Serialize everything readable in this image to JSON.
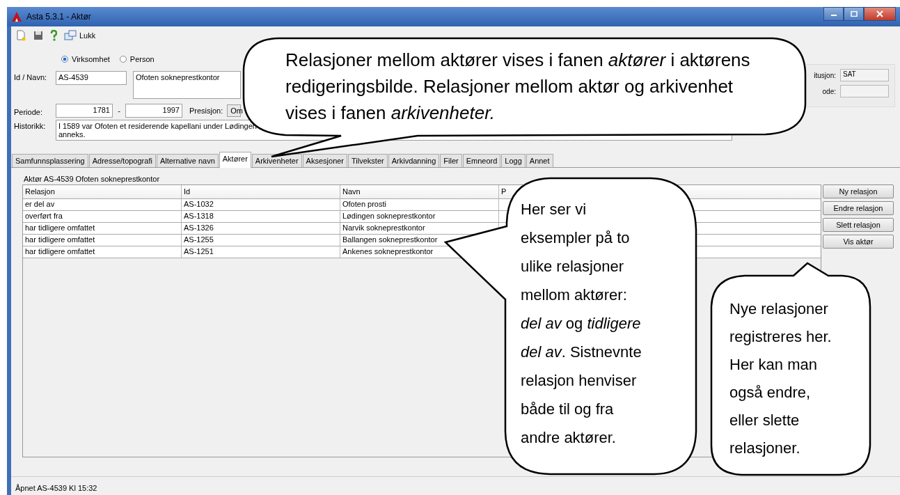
{
  "window": {
    "title": "Asta 5.3.1 - Aktør"
  },
  "toolbar": {
    "close_label": "Lukk"
  },
  "form": {
    "entity_types": [
      {
        "label": "Virksomhet",
        "selected": true
      },
      {
        "label": "Person",
        "selected": false
      }
    ],
    "id_label": "Id / Navn:",
    "id": "AS-4539",
    "name": "Ofoten sokneprestkontor",
    "periode_label": "Periode:",
    "periode_from": "1781",
    "periode_dash": "-",
    "periode_to": "1997",
    "presisjon_label": "Presisjon:",
    "presisjon_value": "Om",
    "historikk_label": "Historikk:",
    "historikk_value": "I 1589 var Ofoten et residerende kapellani under Lødingen\nanneks.",
    "side_fields": [
      {
        "label": "itusjon:",
        "value": "SAT"
      },
      {
        "label": "ode:"
      }
    ]
  },
  "tabs": [
    {
      "label": "Samfunnsplassering",
      "selected": false
    },
    {
      "label": "Adresse/topografi",
      "selected": false
    },
    {
      "label": "Alternative navn",
      "selected": false
    },
    {
      "label": "Aktører",
      "selected": true
    },
    {
      "label": "Arkivenheter",
      "selected": false
    },
    {
      "label": "Aksesjoner",
      "selected": false
    },
    {
      "label": "Tilvekster",
      "selected": false
    },
    {
      "label": "Arkivdanning",
      "selected": false
    },
    {
      "label": "Filer",
      "selected": false
    },
    {
      "label": "Emneord",
      "selected": false
    },
    {
      "label": "Logg",
      "selected": false
    },
    {
      "label": "Annet",
      "selected": false
    }
  ],
  "panel_title": "Aktør  AS-4539  Ofoten sokneprestkontor",
  "table": {
    "columns": [
      "Relasjon",
      "Id",
      "Navn",
      "P"
    ],
    "rows": [
      [
        "er del av",
        "AS-1032",
        "Ofoten prosti"
      ],
      [
        "overført fra",
        "AS-1318",
        "Lødingen sokneprestkontor"
      ],
      [
        "har tidligere omfattet",
        "AS-1326",
        "Narvik sokneprestkontor"
      ],
      [
        "har tidligere omfattet",
        "AS-1255",
        "Ballangen sokneprestkontor"
      ],
      [
        "har tidligere omfattet",
        "AS-1251",
        "Ankenes sokneprestkontor"
      ]
    ]
  },
  "buttons": [
    "Ny relasjon",
    "Endre relasjon",
    "Slett relasjon",
    "Vis aktør"
  ],
  "status_bar": "Åpnet AS-4539 Kl 15:32",
  "callouts": [
    "Relasjoner mellom aktører vises i fanen *aktører* i aktørens\nredigeringsbilde. Relasjoner mellom aktør og arkivenhet\nvises i fanen *arkivenheter.*",
    "Her ser vi\neksempler på to\nulike relasjoner\nmellom aktører:\n*del av* og *tidligere*\n*del av*. Sistnevnte\nrelasjon henviser\nbåde til og fra\nandre aktører.",
    "Nye relasjoner\nregistreres her.\nHer kan man\nogså endre,\neller slette\nrelasjoner."
  ]
}
